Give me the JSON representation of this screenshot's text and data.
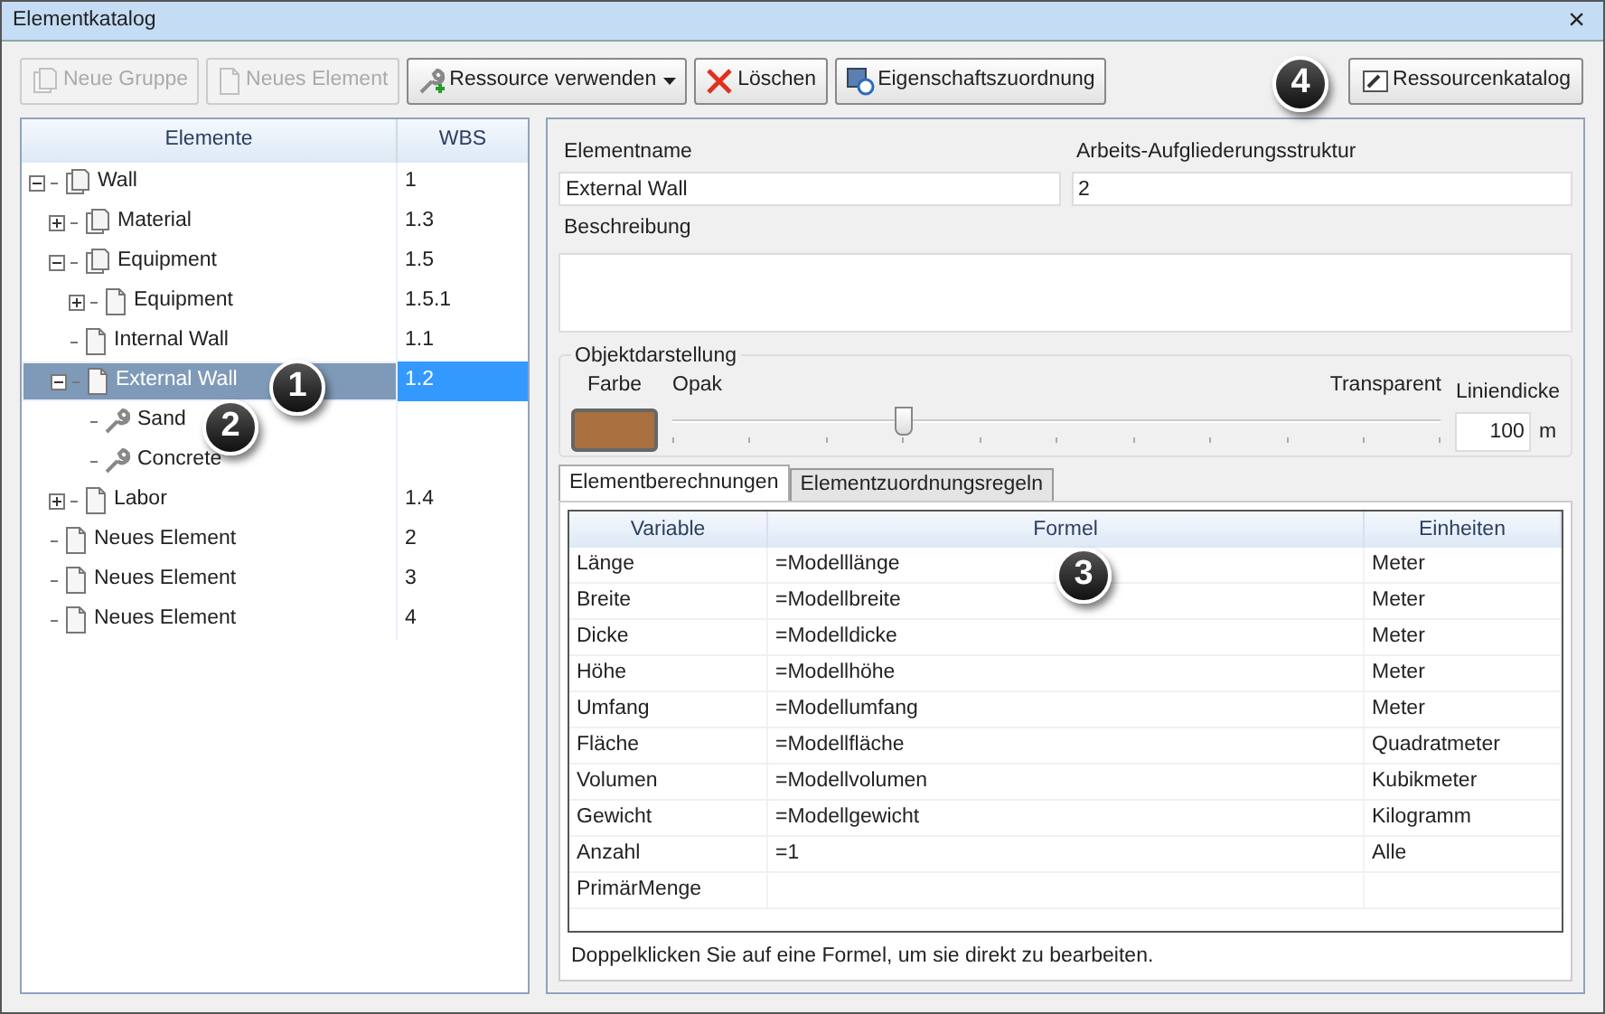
{
  "window": {
    "title": "Elementkatalog",
    "close": "×"
  },
  "toolbar": [
    {
      "label": "Neue Gruppe",
      "kind": "group",
      "disabled": true,
      "dropdown": false
    },
    {
      "label": "Neues Element",
      "kind": "element",
      "disabled": true,
      "dropdown": false
    },
    {
      "label": "Ressource verwenden",
      "kind": "wrench",
      "disabled": false,
      "dropdown": true
    },
    {
      "label": "Löschen",
      "kind": "delete",
      "disabled": false,
      "dropdown": false
    },
    {
      "label": "Eigenschaftszuordnung",
      "kind": "mapping",
      "disabled": false,
      "dropdown": false
    }
  ],
  "toolbar_right": {
    "label": "Ressourcenkatalog",
    "kind": "catalog"
  },
  "tree": {
    "columns": [
      "Elemente",
      "WBS"
    ],
    "items": [
      {
        "name": "Wall",
        "wbs": "1",
        "kind": "group",
        "expanded": true,
        "selected": false,
        "children": [
          {
            "name": "Material",
            "wbs": "1.3",
            "kind": "group",
            "expanded": false,
            "selected": false
          },
          {
            "name": "Equipment",
            "wbs": "1.5",
            "kind": "group",
            "expanded": true,
            "selected": false,
            "children": [
              {
                "name": "Equipment",
                "wbs": "1.5.1",
                "kind": "page",
                "expanded": false,
                "selected": false
              }
            ]
          },
          {
            "name": "Internal Wall",
            "wbs": "1.1",
            "kind": "page",
            "selected": false
          },
          {
            "name": "External Wall",
            "wbs": "1.2",
            "kind": "page",
            "expanded": true,
            "selected": true,
            "children": [
              {
                "name": "Sand",
                "kind": "resource",
                "selected": false
              },
              {
                "name": "Concrete",
                "kind": "resource",
                "selected": false
              }
            ]
          },
          {
            "name": "Labor",
            "wbs": "1.4",
            "kind": "page",
            "expanded": false,
            "selected": false
          }
        ]
      },
      {
        "name": "Neues Element",
        "wbs": "2",
        "kind": "page",
        "selected": false
      },
      {
        "name": "Neues Element",
        "wbs": "3",
        "kind": "page",
        "selected": false
      },
      {
        "name": "Neues Element",
        "wbs": "4",
        "kind": "page",
        "selected": false
      }
    ]
  },
  "details": {
    "name_label": "Elementname",
    "name_value": "External Wall",
    "wbs_label": "Arbeits-Aufgliederungsstruktur",
    "wbs_value": "2",
    "description_label": "Beschreibung"
  },
  "objektdarstellung": {
    "title": "Objektdarstellung",
    "color_label": "Farbe",
    "color": "#a8703e",
    "opaque_label": "Opak",
    "transparent_label": "Transparent",
    "opacity": {
      "level": 0.3
    },
    "line_label": "Liniendicke",
    "line_value": "100",
    "line_unit": "m"
  },
  "tabs": [
    {
      "label": "Elementberechnungen",
      "selected": true
    },
    {
      "label": "Elementzuordnungsregeln",
      "selected": false
    }
  ],
  "table": {
    "columns": [
      "Variable",
      "Formel",
      "Einheiten"
    ],
    "rows": [
      [
        "Länge",
        "=Modelllänge",
        "Meter"
      ],
      [
        "Breite",
        "=Modellbreite",
        "Meter"
      ],
      [
        "Dicke",
        "=Modelldicke",
        "Meter"
      ],
      [
        "Höhe",
        "=Modellhöhe",
        "Meter"
      ],
      [
        "Umfang",
        "=Modellumfang",
        "Meter"
      ],
      [
        "Fläche",
        "=Modellfläche",
        "Quadratmeter"
      ],
      [
        "Volumen",
        "=Modellvolumen",
        "Kubikmeter"
      ],
      [
        "Gewicht",
        "=Modellgewicht",
        "Kilogramm"
      ],
      [
        "Anzahl",
        "=1",
        "Alle"
      ],
      [
        "PrimärMenge",
        "",
        ""
      ]
    ]
  },
  "hint": "Doppelklicken Sie auf eine Formel, um sie direkt zu bearbeiten.",
  "callouts": [
    "1",
    "2",
    "3",
    "4"
  ]
}
